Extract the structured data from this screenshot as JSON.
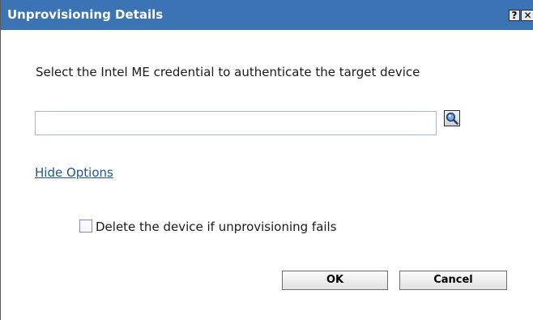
{
  "window": {
    "title": "Unprovisioning Details",
    "help_glyph": "?",
    "close_glyph": "✕"
  },
  "form": {
    "prompt": "Select the Intel ME credential to authenticate the target device",
    "credential_value": "",
    "credential_placeholder": "",
    "search_icon": "magnifier-icon",
    "hide_options_label": "Hide Options",
    "delete_checkbox_label": "Delete the device if unprovisioning fails",
    "delete_checkbox_checked": false
  },
  "buttons": {
    "ok_label": "OK",
    "cancel_label": "Cancel"
  },
  "colors": {
    "titlebar": "#3b73b5",
    "link": "#1c55a6"
  }
}
